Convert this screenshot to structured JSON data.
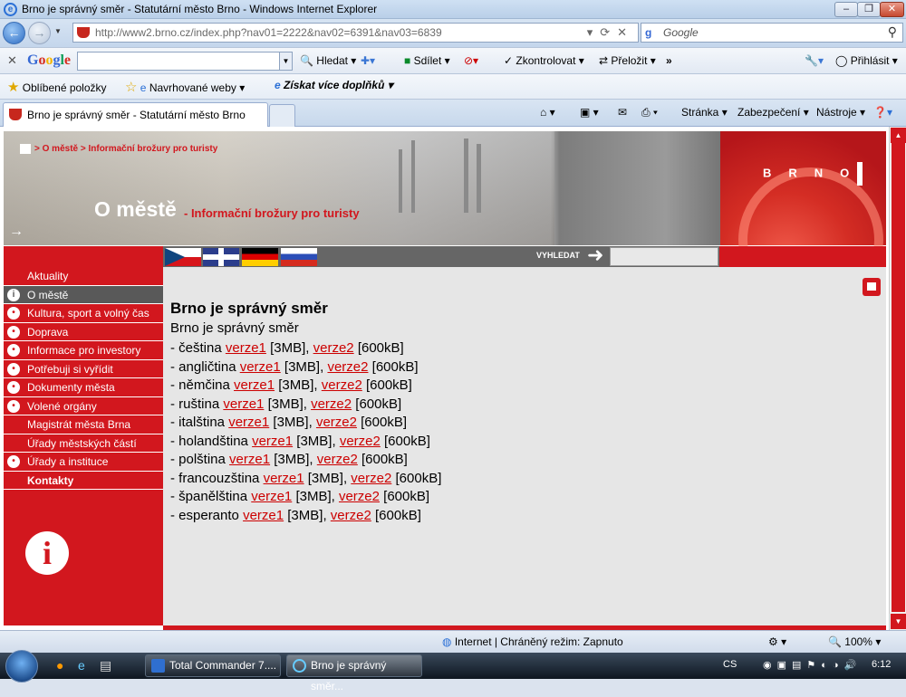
{
  "window": {
    "title": "Brno je správný směr - Statutární město Brno - Windows Internet Explorer"
  },
  "address": {
    "url": "http://www2.brno.cz/index.php?nav01=2222&nav02=6391&nav03=6839",
    "search_placeholder": "Google"
  },
  "google_toolbar": {
    "logo": "Google",
    "items": [
      "Hledat",
      "Sdílet",
      "Zkontrolovat",
      "Přeložit",
      "»",
      "Přihlásit"
    ]
  },
  "favorites_bar": {
    "favorites": "Oblíbené položky",
    "suggested": "Navrhované weby",
    "addons": "Získat více doplňků"
  },
  "tab": {
    "title": "Brno je správný směr - Statutární město Brno"
  },
  "command_bar": {
    "page": "Stránka",
    "security": "Zabezpečení",
    "tools": "Nástroje"
  },
  "banner": {
    "breadcrumb": "> O městě > Informační brožury pro turisty",
    "title": "O městě",
    "subtitle": "- Informační brožury pro turisty",
    "logo": "BRNO",
    "search_label": "VYHLEDAT"
  },
  "sidebar": {
    "items": [
      {
        "label": "Aktuality",
        "icon": ""
      },
      {
        "label": "O městě",
        "icon": "info-icon"
      },
      {
        "label": "Kultura, sport a volný čas",
        "icon": "theater-icon"
      },
      {
        "label": "Doprava",
        "icon": "tram-icon"
      },
      {
        "label": "Informace pro investory",
        "icon": "investor-icon"
      },
      {
        "label": "Potřebuji si vyřídit",
        "icon": "signpost-icon"
      },
      {
        "label": "Dokumenty města",
        "icon": "document-icon"
      },
      {
        "label": "Volené orgány",
        "icon": "people-icon"
      },
      {
        "label": "Magistrát města Brna",
        "icon": ""
      },
      {
        "label": "Úřady městských částí",
        "icon": ""
      },
      {
        "label": "Úřady a instituce",
        "icon": "signpost-icon"
      },
      {
        "label": "Kontakty",
        "icon": ""
      }
    ]
  },
  "content": {
    "heading": "Brno je správný směr",
    "subheading": "Brno je správný směr",
    "languages": [
      {
        "lang": "- čeština",
        "v1": "verze1",
        "s1": "[3MB],",
        "v2": "verze2",
        "s2": "[600kB]"
      },
      {
        "lang": "- angličtina",
        "v1": "verze1",
        "s1": "[3MB],",
        "v2": "verze2",
        "s2": "[600kB]"
      },
      {
        "lang": "- němčina",
        "v1": "verze1",
        "s1": "[3MB],",
        "v2": "verze2",
        "s2": "[600kB]"
      },
      {
        "lang": "- ruština",
        "v1": "verze1",
        "s1": "[3MB],",
        "v2": "verze2",
        "s2": "[600kB]"
      },
      {
        "lang": "- italština",
        "v1": "verze1",
        "s1": "[3MB],",
        "v2": "verze2",
        "s2": "[600kB]"
      },
      {
        "lang": "- holandština",
        "v1": "verze1",
        "s1": "[3MB],",
        "v2": "verze2",
        "s2": "[600kB]"
      },
      {
        "lang": "- polština",
        "v1": "verze1",
        "s1": "[3MB],",
        "v2": "verze2",
        "s2": "[600kB]"
      },
      {
        "lang": "- francouzština",
        "v1": "verze1",
        "s1": "[3MB],",
        "v2": "verze2",
        "s2": "[600kB]"
      },
      {
        "lang": "- španělština",
        "v1": "verze1",
        "s1": "[3MB],",
        "v2": "verze2",
        "s2": "[600kB]"
      },
      {
        "lang": "- esperanto",
        "v1": "verze1",
        "s1": "[3MB],",
        "v2": "verze2",
        "s2": "[600kB]"
      }
    ]
  },
  "status": {
    "zone": "Internet | Chráněný režim: Zapnuto",
    "zoom": "100%"
  },
  "taskbar": {
    "tasks": [
      "Total Commander 7....",
      "Brno je správný směr..."
    ],
    "lang": "CS",
    "clock": "6:12"
  },
  "colors": {
    "brand_red": "#d2171e",
    "active_gray": "#595959"
  }
}
